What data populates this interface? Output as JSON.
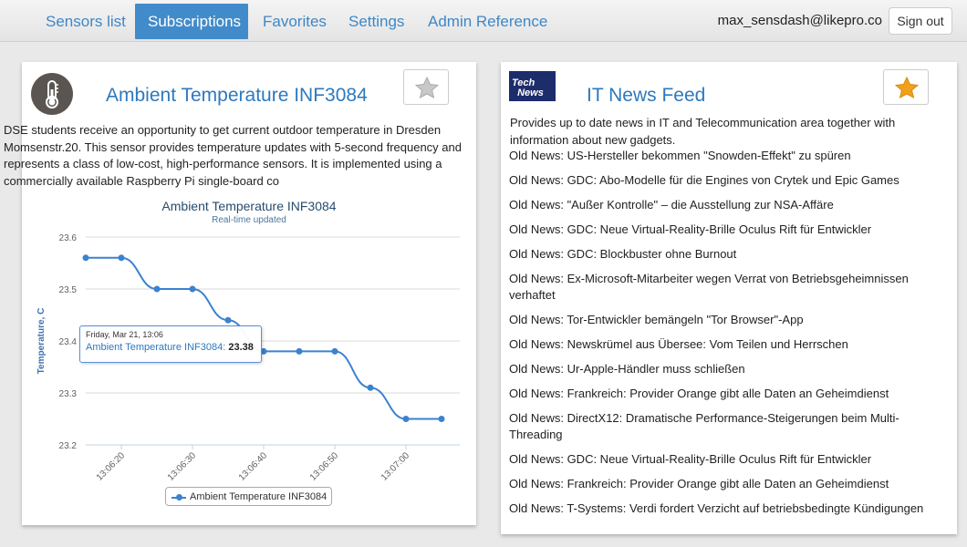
{
  "nav": {
    "items": [
      "Sensors list",
      "Subscriptions",
      "Favorites",
      "Settings",
      "Admin Reference"
    ],
    "active": "Subscriptions",
    "user_email": "max_sensdash@likepro.co",
    "signout_label": "Sign out"
  },
  "sensor_card": {
    "title": "Ambient Temperature INF3084",
    "icon": "thermometer-icon",
    "favorite": false,
    "description": "DSE students receive an opportunity to get current outdoor temperature in Dresden Momsenstr.20. This sensor provides temperature updates with 5-second frequency and represents a class of low-cost, high-performance sensors. It is implemented using a commercially available Raspberry Pi single-board co"
  },
  "chart_data": {
    "type": "line",
    "title": "Ambient Temperature INF3084",
    "subtitle": "Real-time updated",
    "ylabel": "Temperature, C",
    "xlabel": "",
    "ylim": [
      23.2,
      23.6
    ],
    "yticks": [
      "23.6",
      "23.5",
      "23.4",
      "23.3",
      "23.2"
    ],
    "xticks": [
      "13:06:20",
      "13:06:30",
      "13:06:40",
      "13:06:50",
      "13:07:00"
    ],
    "series": [
      {
        "name": "Ambient Temperature INF3084",
        "color": "#3b82cf",
        "x": [
          "13:06:15",
          "13:06:20",
          "13:06:25",
          "13:06:30",
          "13:06:35",
          "13:06:40",
          "13:06:45",
          "13:06:50",
          "13:06:55",
          "13:07:00",
          "13:07:05"
        ],
        "values": [
          23.56,
          23.56,
          23.5,
          23.5,
          23.44,
          23.38,
          23.38,
          23.38,
          23.31,
          23.25,
          23.25
        ]
      }
    ],
    "tooltip": {
      "date": "Friday, Mar 21, 13:06",
      "series": "Ambient Temperature INF3084",
      "value": "23.38"
    },
    "grid": true,
    "legend": "bottom-center"
  },
  "news_card": {
    "title": "IT News Feed",
    "logo_text": "TechNews",
    "favorite": true,
    "star_color": "#f0a019",
    "description": "Provides up to date news in IT and Telecommunication area together with information about new gadgets.",
    "items": [
      "Old News: US-Hersteller bekommen \"Snowden-Effekt\" zu spüren",
      "Old News: GDC: Abo-Modelle für die Engines von Crytek und Epic Games",
      "Old News: \"Außer Kontrolle\" – die Ausstellung zur NSA-Affäre",
      "Old News: GDC: Neue Virtual-Reality-Brille Oculus Rift für Entwickler",
      "Old News: GDC: Blockbuster ohne Burnout",
      "Old News: Ex-Microsoft-Mitarbeiter wegen Verrat von Betriebsgeheimnissen verhaftet",
      "Old News: Tor-Entwickler bemängeln \"Tor Browser\"-App",
      "Old News: Newskrümel aus Übersee: Vom Teilen und Herrschen",
      "Old News: Ur-Apple-Händler muss schließen",
      "Old News: Frankreich: Provider Orange gibt alle Daten an Geheimdienst",
      "Old News: DirectX12: Dramatische Performance-Steigerungen beim Multi-Threading",
      "Old News: GDC: Neue Virtual-Reality-Brille Oculus Rift für Entwickler",
      "Old News: Frankreich: Provider Orange gibt alle Daten an Geheimdienst",
      "Old News: T-Systems: Verdi fordert Verzicht auf betriebsbedingte Kündigungen"
    ]
  }
}
